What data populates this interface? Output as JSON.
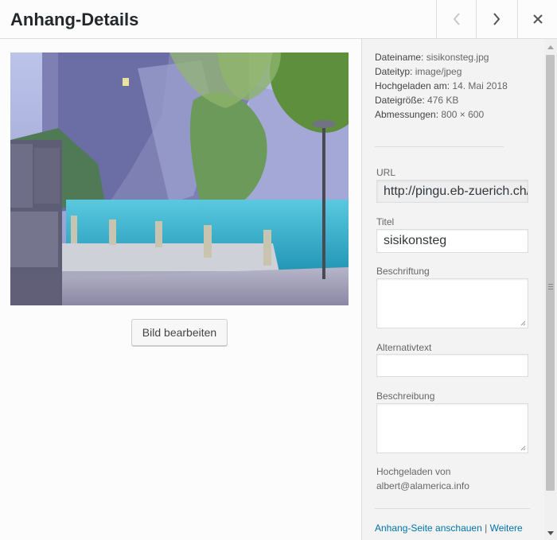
{
  "header": {
    "title": "Anhang-Details",
    "prev_icon": "chevron-left-icon",
    "next_icon": "chevron-right-icon",
    "close_icon": "close-icon"
  },
  "preview": {
    "image_alt": "sisikonsteg",
    "edit_button": "Bild bearbeiten"
  },
  "details": {
    "filename_label": "Dateiname:",
    "filename": "sisikonsteg.jpg",
    "filetype_label": "Dateityp:",
    "filetype": "image/jpeg",
    "uploaded_label": "Hochgeladen am:",
    "uploaded_date": "14. Mai 2018",
    "filesize_label": "Dateigröße:",
    "filesize": "476 KB",
    "dimensions_label": "Abmessungen:",
    "dimensions": "800 × 600"
  },
  "form": {
    "url_label": "URL",
    "url_value": "http://pingu.eb-zuerich.ch/wp-content/uploads/sisikonsteg.jpg",
    "title_label": "Titel",
    "title_value": "sisikonsteg",
    "caption_label": "Beschriftung",
    "alt_label": "Alternativtext",
    "description_label": "Beschreibung",
    "uploaded_by_label": "Hochgeladen von",
    "uploaded_by": "albert@alamerica.info"
  },
  "actions": {
    "view_page": "Anhang-Seite anschauen",
    "separator": "|",
    "more": "Weitere"
  },
  "colors": {
    "link": "#0073aa",
    "sidebar_bg": "#f3f3f3"
  }
}
